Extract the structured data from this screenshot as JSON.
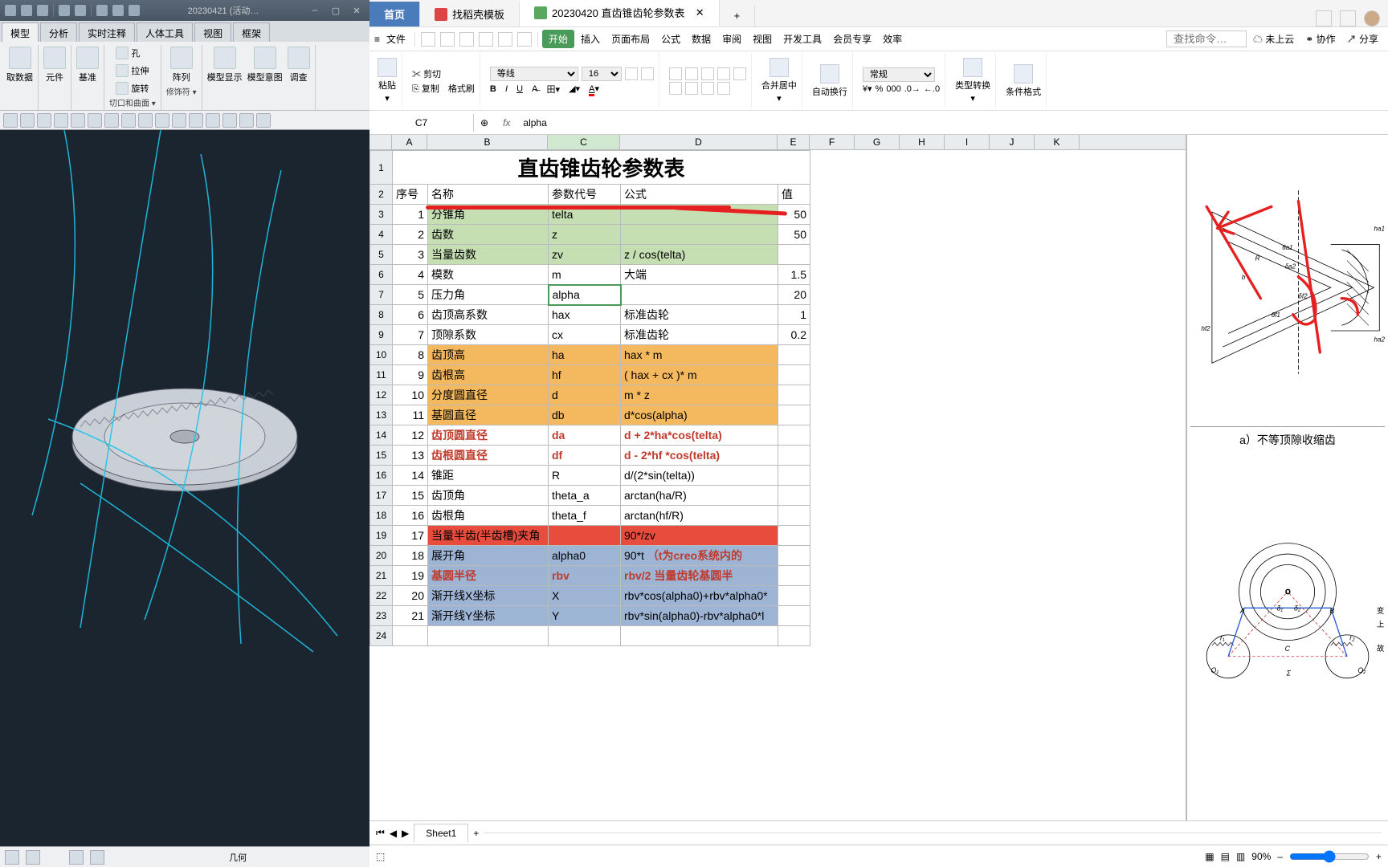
{
  "cad": {
    "title": "20230421 (活动…",
    "tabs": [
      "模型",
      "分析",
      "实时注释",
      "人体工具",
      "视图",
      "框架"
    ],
    "ribbon_groups": [
      {
        "label": "取数据",
        "items": []
      },
      {
        "label": "元件",
        "items": []
      },
      {
        "label": "基准",
        "items": []
      },
      {
        "label": "切口和曲面 ▾",
        "items": [
          "孔",
          "拉伸",
          "旋转"
        ]
      },
      {
        "label": "修饰符 ▾",
        "items": [
          "阵列"
        ]
      },
      {
        "label": "",
        "items": [
          "模型显示",
          "模型意图",
          "调查"
        ]
      }
    ],
    "status": "几何"
  },
  "wps": {
    "tabs": {
      "home": "首页",
      "template": "找稻壳模板",
      "doc": "20230420 直齿锥齿轮参数表"
    },
    "menu": {
      "file": "文件",
      "start": "开始",
      "items": [
        "插入",
        "页面布局",
        "公式",
        "数据",
        "审阅",
        "视图",
        "开发工具",
        "会员专享",
        "效率"
      ],
      "search_ph": "查找命令…",
      "cloud": "未上云",
      "coop": "协作",
      "share": "分享"
    },
    "ribbon": {
      "paste": "粘贴",
      "cut": "剪切",
      "copy": "复制",
      "brush": "格式刷",
      "font": "等线",
      "size": "16",
      "merge": "合并居中",
      "wrap": "自动换行",
      "numfmt": "常规",
      "typeconv": "类型转换",
      "cond": "条件格式"
    },
    "cellref": "C7",
    "formula": "alpha",
    "cols": [
      "A",
      "B",
      "C",
      "D",
      "E",
      "F",
      "G",
      "H",
      "I",
      "J",
      "K"
    ],
    "title": "直齿锥齿轮参数表",
    "headers": {
      "a": "序号",
      "b": "名称",
      "c": "参数代号",
      "d": "公式",
      "e": "值"
    },
    "rows": [
      {
        "n": "1",
        "name": "分锥角",
        "p": "telta",
        "f": "",
        "v": "50",
        "cls": "hl-g"
      },
      {
        "n": "2",
        "name": "齿数",
        "p": "z",
        "f": "",
        "v": "50",
        "cls": "hl-g"
      },
      {
        "n": "3",
        "name": "当量齿数",
        "p": "zv",
        "f": "z / cos(telta)",
        "v": "",
        "cls": "hl-g"
      },
      {
        "n": "4",
        "name": "模数",
        "p": "m",
        "f": "大端",
        "v": "1.5",
        "cls": ""
      },
      {
        "n": "5",
        "name": "压力角",
        "p": "alpha",
        "f": "",
        "v": "20",
        "cls": ""
      },
      {
        "n": "6",
        "name": "齿顶高系数",
        "p": "hax",
        "f": "标准齿轮",
        "v": "1",
        "cls": ""
      },
      {
        "n": "7",
        "name": "顶隙系数",
        "p": "cx",
        "f": "标准齿轮",
        "v": "0.2",
        "cls": ""
      },
      {
        "n": "8",
        "name": "齿顶高",
        "p": "ha",
        "f": "hax * m",
        "v": "",
        "cls": "hl-o"
      },
      {
        "n": "9",
        "name": "齿根高",
        "p": "hf",
        "f": "( hax + cx )* m",
        "v": "",
        "cls": "hl-o"
      },
      {
        "n": "10",
        "name": "分度圆直径",
        "p": "d",
        "f": "m * z",
        "v": "",
        "cls": "hl-o"
      },
      {
        "n": "11",
        "name": "基圆直径",
        "p": "db",
        "f": "d*cos(alpha)",
        "v": "",
        "cls": "hl-o"
      },
      {
        "n": "12",
        "name": "齿顶圆直径",
        "p": "da",
        "f": "d + 2*ha*cos(telta)",
        "v": "",
        "cls": "",
        "red": true
      },
      {
        "n": "13",
        "name": "齿根圆直径",
        "p": "df",
        "f": "d - 2*hf *cos(telta)",
        "v": "",
        "cls": "",
        "red": true
      },
      {
        "n": "14",
        "name": "锥距",
        "p": "R",
        "f": "d/(2*sin(telta))",
        "v": "",
        "cls": ""
      },
      {
        "n": "15",
        "name": "齿顶角",
        "p": "theta_a",
        "f": "arctan(ha/R)",
        "v": "",
        "cls": ""
      },
      {
        "n": "16",
        "name": "齿根角",
        "p": "theta_f",
        "f": "arctan(hf/R)",
        "v": "",
        "cls": ""
      },
      {
        "n": "17",
        "name": "当量半齿(半齿槽)夹角",
        "p": "",
        "f": "90*/zv",
        "v": "",
        "cls": "hl-r"
      },
      {
        "n": "18",
        "name": "展开角",
        "p": "alpha0",
        "f": "90*t",
        "v": "",
        "cls": "hl-b",
        "note": "（t为creo系统内的"
      },
      {
        "n": "19",
        "name": "基圆半径",
        "p": "rbv",
        "f": "rbv/2",
        "v": "",
        "cls": "hl-b",
        "red": true,
        "note": "当量齿轮基圆半"
      },
      {
        "n": "20",
        "name": "渐开线X坐标",
        "p": "X",
        "f": "rbv*cos(alpha0)+rbv*alpha0*",
        "v": "",
        "cls": "hl-b"
      },
      {
        "n": "21",
        "name": "渐开线Y坐标",
        "p": "Y",
        "f": "rbv*sin(alpha0)-rbv*alpha0*l",
        "v": "",
        "cls": "hl-b"
      }
    ],
    "diag_caption": "a）不等顶隙收缩齿",
    "sheet": "Sheet1",
    "zoom": "90%"
  }
}
